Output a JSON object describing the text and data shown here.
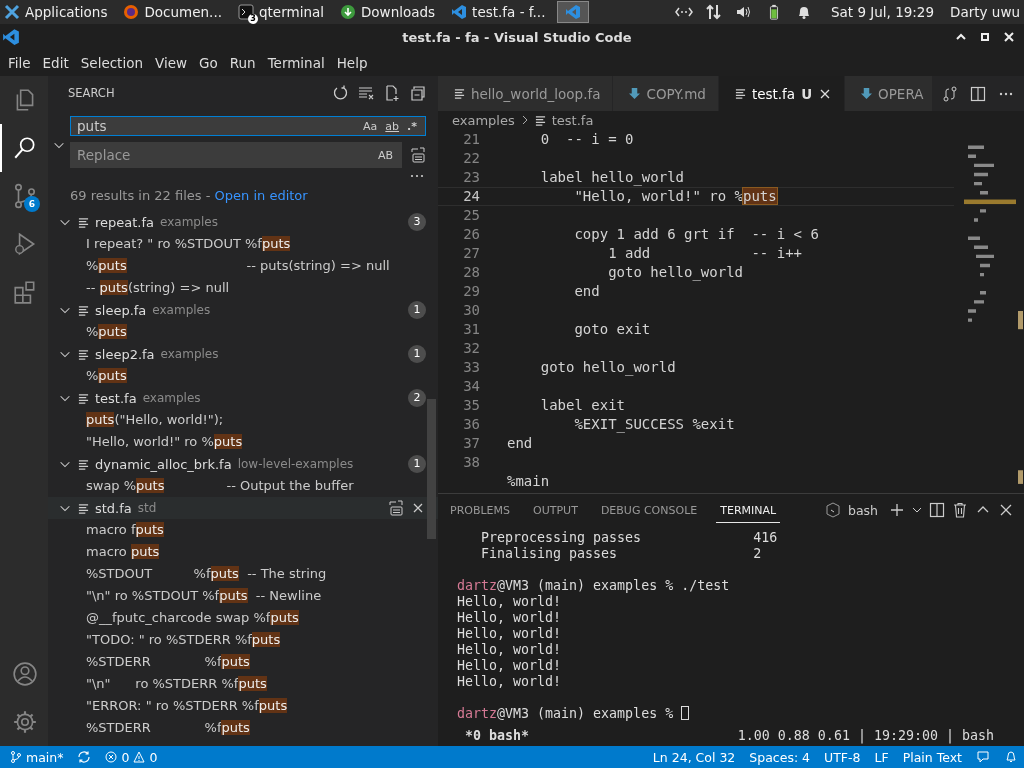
{
  "taskbar": {
    "apps_label": "Applications",
    "tasks": [
      {
        "kind": "firefox",
        "label": "Documen..."
      },
      {
        "kind": "terminal",
        "label": "qterminal",
        "badge": "3"
      },
      {
        "kind": "download",
        "label": "Downloads"
      },
      {
        "kind": "vscode",
        "label": "test.fa - f..."
      }
    ],
    "clock": "Sat  9 Jul, 19:29",
    "user": "Darty uwu"
  },
  "window": {
    "title": "test.fa - fa - Visual Studio Code"
  },
  "menu": [
    "File",
    "Edit",
    "Selection",
    "View",
    "Go",
    "Run",
    "Terminal",
    "Help"
  ],
  "activity": [
    {
      "kind": "explorer",
      "selected": false
    },
    {
      "kind": "search",
      "selected": true
    },
    {
      "kind": "source-control",
      "selected": false,
      "badge": "6"
    },
    {
      "kind": "run",
      "selected": false
    },
    {
      "kind": "extensions",
      "selected": false
    }
  ],
  "activity_bottom": [
    {
      "kind": "account"
    },
    {
      "kind": "settings"
    }
  ],
  "sidebar": {
    "title": "SEARCH",
    "search": {
      "value": "puts",
      "options": [
        "Aa",
        "ab",
        ".*"
      ]
    },
    "replace": {
      "placeholder": "Replace",
      "option": "AB"
    },
    "summary": "69 results in 22 files - ",
    "summary_link": "Open in editor",
    "results": [
      {
        "file": "repeat.fa",
        "folder": "examples",
        "count": "3",
        "expanded": true,
        "hovered": false,
        "matches": [
          {
            "pre": "I repeat? \" ro %STDOUT %f",
            "hit": "puts"
          },
          {
            "pre": "%",
            "hit": "puts",
            "post": "                             -- puts(string) => null"
          },
          {
            "pre": "-- ",
            "hit": "puts",
            "post": "(string) => null"
          }
        ]
      },
      {
        "file": "sleep.fa",
        "folder": "examples",
        "count": "1",
        "expanded": true,
        "hovered": false,
        "matches": [
          {
            "pre": "%",
            "hit": "puts"
          }
        ]
      },
      {
        "file": "sleep2.fa",
        "folder": "examples",
        "count": "1",
        "expanded": true,
        "hovered": false,
        "matches": [
          {
            "pre": "%",
            "hit": "puts"
          }
        ]
      },
      {
        "file": "test.fa",
        "folder": "examples",
        "count": "2",
        "expanded": true,
        "hovered": false,
        "matches": [
          {
            "hit": "puts",
            "post": "(\"Hello, world!\");"
          },
          {
            "pre": "\"Hello, world!\" ro %",
            "hit": "puts"
          }
        ]
      },
      {
        "file": "dynamic_alloc_brk.fa",
        "folder": "low-level-examples",
        "count": "1",
        "expanded": true,
        "hovered": false,
        "matches": [
          {
            "pre": "swap %",
            "hit": "puts",
            "post": "               -- Output the buffer"
          }
        ]
      },
      {
        "file": "std.fa",
        "folder": "std",
        "expanded": true,
        "hovered": true,
        "matches": [
          {
            "pre": "macro f",
            "hit": "puts"
          },
          {
            "pre": "macro ",
            "hit": "puts"
          },
          {
            "pre": "%STDOUT          %f",
            "hit": "puts",
            "post": "  -- The string"
          },
          {
            "pre": "\"\\n\" ro %STDOUT %f",
            "hit": "puts",
            "post": "  -- Newline"
          },
          {
            "pre": "@__fputc_charcode swap %f",
            "hit": "puts"
          },
          {
            "pre": "\"TODO: \" ro %STDERR %f",
            "hit": "puts"
          },
          {
            "pre": "%STDERR             %f",
            "hit": "puts"
          },
          {
            "pre": "\"\\n\"      ro %STDERR %f",
            "hit": "puts"
          },
          {
            "pre": "\"ERROR: \" ro %STDERR %f",
            "hit": "puts"
          },
          {
            "pre": "%STDERR             %f",
            "hit": "puts"
          }
        ]
      }
    ]
  },
  "editor": {
    "tabs": [
      {
        "kind": "fa",
        "label": "hello_world_loop.fa",
        "selected": false
      },
      {
        "kind": "md",
        "label": "COPY.md",
        "selected": false
      },
      {
        "kind": "fa",
        "label": "test.fa",
        "selected": true,
        "status": "U"
      },
      {
        "kind": "md",
        "label": "OPERA",
        "selected": false
      }
    ],
    "breadcrumb": [
      "examples",
      "test.fa"
    ],
    "lines": [
      {
        "n": "21",
        "text": "    0  -- i = 0",
        "current": false
      },
      {
        "n": "22",
        "current": false
      },
      {
        "n": "23",
        "text": "    label hello_world",
        "current": false
      },
      {
        "n": "24",
        "text": "        \"Hello, world!\" ro %",
        "hit": "puts",
        "current": true
      },
      {
        "n": "25",
        "current": false
      },
      {
        "n": "26",
        "text": "        copy 1 add 6 grt if  -- i < 6",
        "current": false
      },
      {
        "n": "27",
        "text": "            1 add            -- i++",
        "current": false
      },
      {
        "n": "28",
        "text": "            goto hello_world",
        "current": false
      },
      {
        "n": "29",
        "text": "        end",
        "current": false
      },
      {
        "n": "30",
        "current": false
      },
      {
        "n": "31",
        "text": "        goto exit",
        "current": false
      },
      {
        "n": "32",
        "current": false
      },
      {
        "n": "33",
        "text": "    goto hello_world",
        "current": false
      },
      {
        "n": "34",
        "current": false
      },
      {
        "n": "35",
        "text": "    label exit",
        "current": false
      },
      {
        "n": "36",
        "text": "        %EXIT_SUCCESS %exit",
        "current": false
      },
      {
        "n": "37",
        "text": "end",
        "current": false
      },
      {
        "n": "38",
        "current": false
      },
      {
        "text": "%main",
        "current": false
      }
    ]
  },
  "panel": {
    "tabs": [
      {
        "label": "PROBLEMS",
        "selected": false
      },
      {
        "label": "OUTPUT",
        "selected": false
      },
      {
        "label": "DEBUG CONSOLE",
        "selected": false
      },
      {
        "label": "TERMINAL",
        "selected": true
      }
    ],
    "shell": "bash",
    "lines": [
      {
        "kind": "output",
        "text": "   Preprocessing passes              416"
      },
      {
        "kind": "output",
        "text": "   Finalising passes                 2"
      },
      {
        "kind": "blank"
      },
      {
        "kind": "prompt",
        "user": "dartz",
        "rest": "@VM3 (main) examples % ",
        "command": "./test",
        "cursor": false
      },
      {
        "kind": "output",
        "text": "Hello, world!"
      },
      {
        "kind": "output",
        "text": "Hello, world!"
      },
      {
        "kind": "output",
        "text": "Hello, world!"
      },
      {
        "kind": "output",
        "text": "Hello, world!"
      },
      {
        "kind": "output",
        "text": "Hello, world!"
      },
      {
        "kind": "output",
        "text": "Hello, world!"
      },
      {
        "kind": "blank"
      },
      {
        "kind": "prompt",
        "user": "dartz",
        "rest": "@VM3 (main) examples % ",
        "cursor": true
      }
    ],
    "tmux_left": "*0 bash*",
    "tmux_right": "1.00 0.88 0.61 | 19:29:00 | bash"
  },
  "status_bar": {
    "branch": "main*",
    "errors": "0",
    "warnings": "0",
    "right": [
      "Ln 24, Col 32",
      "Spaces: 4",
      "UTF-8",
      "LF",
      "Plain Text"
    ]
  }
}
